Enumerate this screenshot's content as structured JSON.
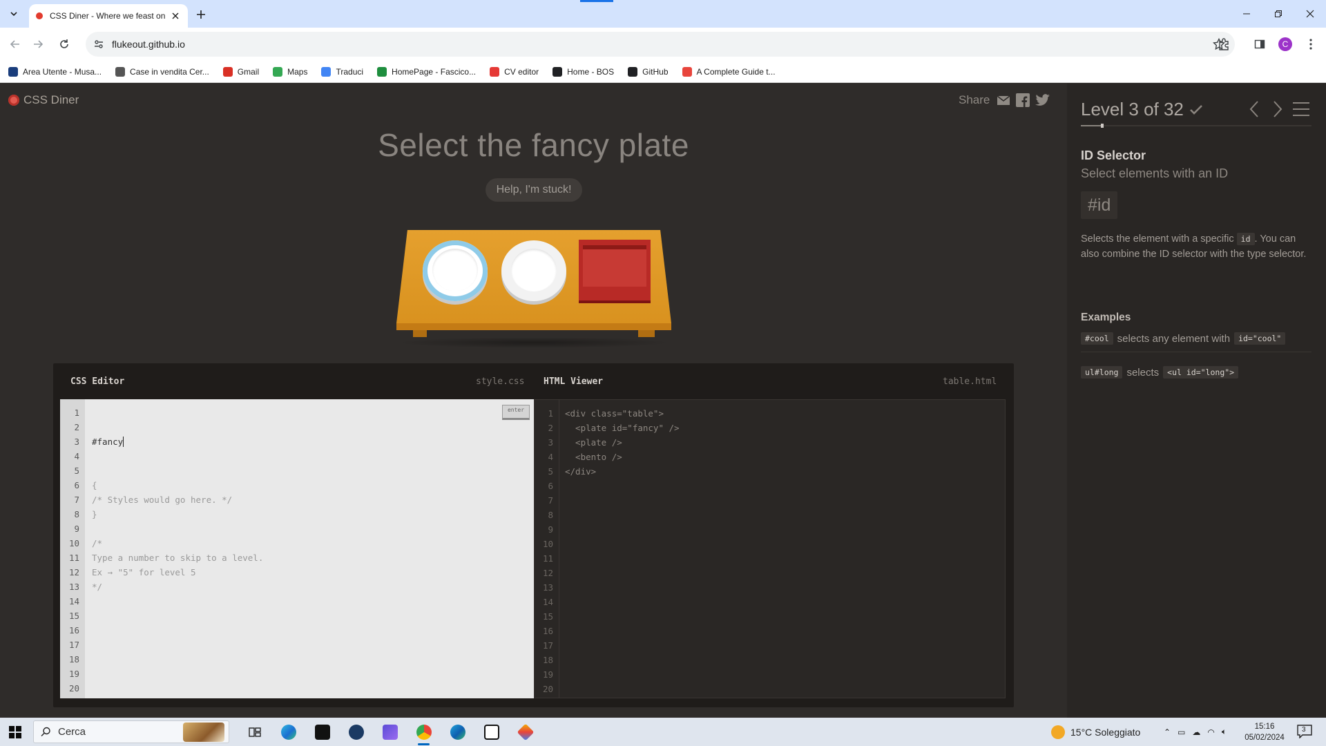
{
  "browser": {
    "tab_title": "CSS Diner - Where we feast on",
    "url": "flukeout.github.io",
    "profile_initial": "C",
    "bookmarks": [
      {
        "label": "Area Utente - Musa...",
        "color": "#1a3d7c"
      },
      {
        "label": "Case in vendita Cer...",
        "color": "#555555"
      },
      {
        "label": "Gmail",
        "color": "#d93025"
      },
      {
        "label": "Maps",
        "color": "#34a853"
      },
      {
        "label": "Traduci",
        "color": "#4285f4"
      },
      {
        "label": "HomePage - Fascico...",
        "color": "#1e8e3e"
      },
      {
        "label": "CV editor",
        "color": "#e53935"
      },
      {
        "label": "Home - BOS",
        "color": "#202124"
      },
      {
        "label": "GitHub",
        "color": "#202124"
      },
      {
        "label": "A Complete Guide t...",
        "color": "#e8453c"
      }
    ]
  },
  "app": {
    "logo": "CSS Diner",
    "share_label": "Share",
    "order": "Select the fancy plate",
    "help_button": "Help, I'm stuck!"
  },
  "editor": {
    "css_title": "CSS Editor",
    "css_file": "style.css",
    "html_title": "HTML Viewer",
    "html_file": "table.html",
    "enter_label": "enter",
    "css_input": "#fancy",
    "css_lines": [
      "{",
      "/* Styles would go here. */",
      "}",
      "",
      "/*",
      "Type a number to skip to a level.",
      "Ex → \"5\" for level 5",
      "*/"
    ],
    "html_lines": [
      "<div class=\"table\">",
      "  <plate id=\"fancy\" />",
      "  <plate />",
      "  <bento />",
      "</div>"
    ],
    "line_count": 20
  },
  "sidebar": {
    "level_label": "Level 3 of 32",
    "progress_fraction": 0.0938,
    "title": "ID Selector",
    "subtitle": "Select elements with an ID",
    "syntax": "#id",
    "desc_pre": "Selects the element with a specific",
    "desc_code": "id",
    "desc_post": ". You can also combine the ID selector with the type selector.",
    "examples_header": "Examples",
    "ex1_code": "#cool",
    "ex1_text": "selects any element with",
    "ex1_code2": "id=\"cool\"",
    "ex2_code": "ul#long",
    "ex2_text": "selects",
    "ex2_code2": "<ul id=\"long\">"
  },
  "taskbar": {
    "search_placeholder": "Cerca",
    "weather": "15°C Soleggiato",
    "time": "15:16",
    "date": "05/02/2024",
    "notifications": "3"
  }
}
